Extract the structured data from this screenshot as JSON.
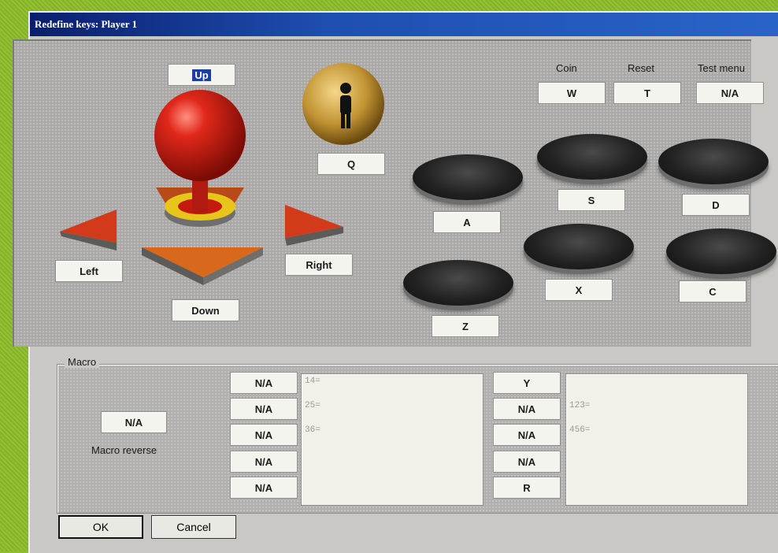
{
  "window": {
    "title": "Redefine keys: Player 1"
  },
  "joystick": {
    "up_key": "Up",
    "left_label": "Left",
    "right_label": "Right",
    "down_label": "Down"
  },
  "start_button": {
    "key": "Q"
  },
  "system": {
    "coin_label": "Coin",
    "coin_key": "W",
    "reset_label": "Reset",
    "reset_key": "T",
    "test_label": "Test menu",
    "test_key": "N/A"
  },
  "buttons": {
    "a": "A",
    "s": "S",
    "d": "D",
    "z": "Z",
    "x": "X",
    "c": "C"
  },
  "macro": {
    "title": "Macro",
    "reverse_key": "N/A",
    "reverse_label": "Macro reverse",
    "left_keys": [
      "N/A",
      "N/A",
      "N/A",
      "N/A",
      "N/A"
    ],
    "left_lines": [
      "14=",
      "25=",
      "36="
    ],
    "right_keys": [
      "Y",
      "N/A",
      "N/A",
      "N/A",
      "R"
    ],
    "right_lines": [
      "",
      "123=",
      "456="
    ]
  },
  "footer": {
    "ok_label": "OK",
    "cancel_label": "Cancel"
  },
  "colors": {
    "title_bar": "#1e4fb0",
    "joystick_ball": "#cc1b10",
    "arrow": "#d23a1a"
  }
}
